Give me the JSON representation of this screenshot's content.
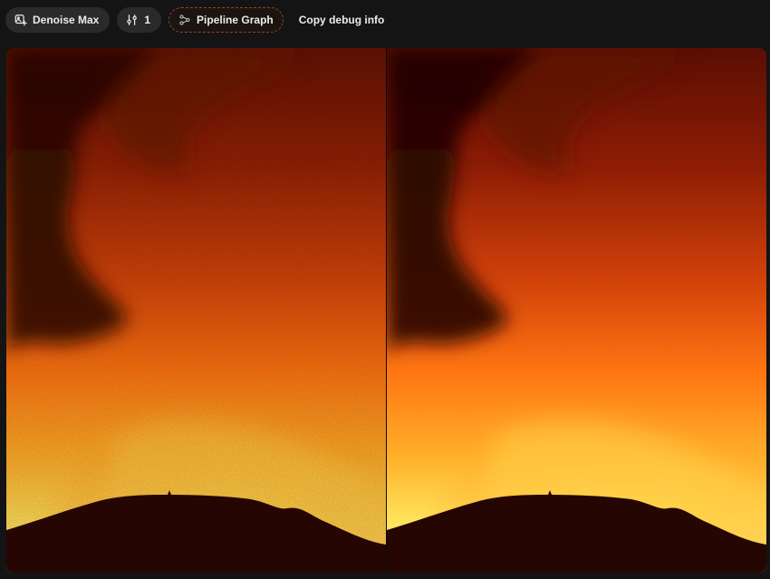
{
  "toolbar": {
    "denoise_label": "Denoise Max",
    "adjust_count": "1",
    "pipeline_label": "Pipeline Graph",
    "debug_label": "Copy debug info"
  },
  "icons": {
    "denoise": "image-sparkle-icon",
    "adjust": "sliders-icon",
    "pipeline": "graph-nodes-icon"
  },
  "colors": {
    "background": "#141414",
    "pill": "#2a2a2a",
    "accent_border": "#8a4a24",
    "fire_bright": "#fff27a",
    "fire_mid": "#ff7a12",
    "fire_dark": "#8a1a04",
    "smoke": "#3a0903",
    "hill": "#260603"
  },
  "viewer": {
    "mode": "split-compare",
    "left_pane": "original",
    "right_pane": "denoised"
  }
}
